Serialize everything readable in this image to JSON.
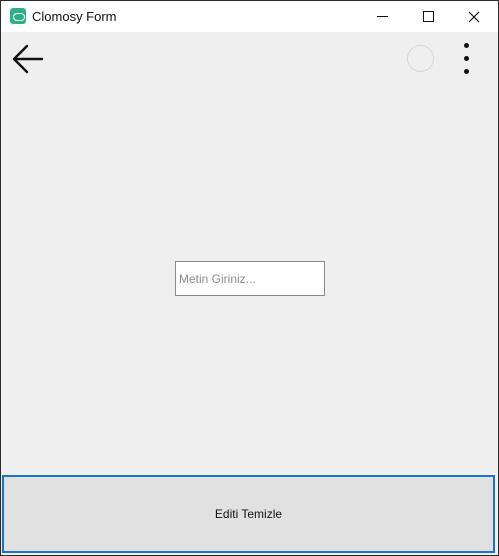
{
  "window": {
    "title": "Clomosy Form",
    "app_icon": "clomosy-app-icon",
    "controls": {
      "minimize_icon": "minimize-icon",
      "maximize_icon": "maximize-icon",
      "close_icon": "close-icon"
    }
  },
  "toolbar": {
    "back_icon": "arrow-left-icon",
    "circle_icon": "circle-icon",
    "menu_icon": "more-vertical-icon"
  },
  "form": {
    "input_value": "",
    "input_placeholder": "Metin Giriniz..."
  },
  "bottom_button": {
    "label": "Editi Temizle"
  },
  "colors": {
    "background": "#efefef",
    "titlebar": "#ffffff",
    "button_face": "#e1e1e1",
    "focus_border": "#1a73c9",
    "app_icon": "#2fae8a"
  }
}
